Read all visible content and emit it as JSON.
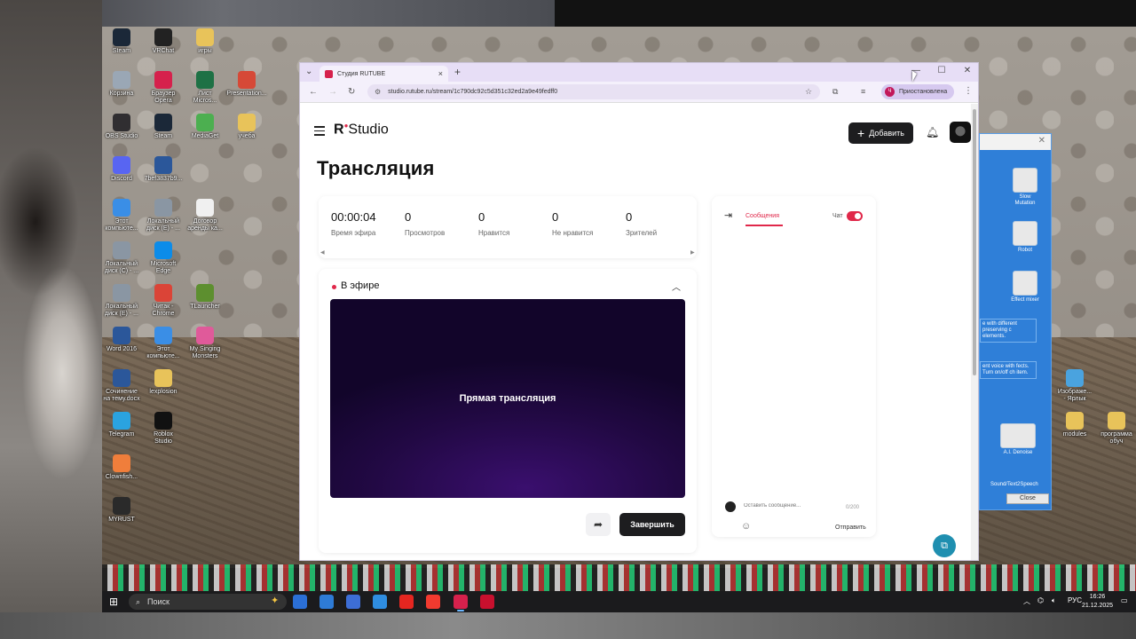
{
  "desktop": {
    "icons": [
      {
        "label": "Steam",
        "icon": "steam-icon",
        "color": "#1b2838"
      },
      {
        "label": "VRChat",
        "icon": "vrchat-icon",
        "color": "#222222"
      },
      {
        "label": "игры",
        "icon": "folder-icon",
        "color": "#e8c35a"
      },
      {
        "label": "Корзина",
        "icon": "recycle-bin-icon",
        "color": "#9aa7b5"
      },
      {
        "label": "Браузер\nOpera",
        "icon": "opera-icon",
        "color": "#d6214c"
      },
      {
        "label": "Лист\nMicros...",
        "icon": "excel-icon",
        "color": "#1e7145"
      },
      {
        "label": "Presentation...",
        "icon": "chrome-app-icon",
        "color": "#d64937"
      },
      {
        "label": "OBS Studio",
        "icon": "obs-icon",
        "color": "#302e31"
      },
      {
        "label": "Steam",
        "icon": "steam-icon",
        "color": "#1b2838"
      },
      {
        "label": "MediaGet",
        "icon": "mediaget-icon",
        "color": "#4caf50"
      },
      {
        "label": "учеба",
        "icon": "folder-icon",
        "color": "#e8c35a"
      },
      {
        "label": "Discord",
        "icon": "discord-icon",
        "color": "#5865f2"
      },
      {
        "label": "7bef3837b9...",
        "icon": "word-icon",
        "color": "#2b579a"
      },
      {
        "label": "Этот\nкомпьюте...",
        "icon": "computer-icon",
        "color": "#3a8ee6"
      },
      {
        "label": "Локальный\nдиск (E) - ...",
        "icon": "drive-icon",
        "color": "#8a96a3"
      },
      {
        "label": "Договор\nаренды ка...",
        "icon": "document-icon",
        "color": "#f0f0f0"
      },
      {
        "label": "Локальный\nдиск (C) - ...",
        "icon": "drive-icon",
        "color": "#8a96a3"
      },
      {
        "label": "Microsoft\nEdge",
        "icon": "edge-icon",
        "color": "#0c8ce9"
      },
      {
        "label": "Локальный\nдиск (E) - ...",
        "icon": "drive-icon",
        "color": "#8a96a3"
      },
      {
        "label": "Читак -\nChrome",
        "icon": "chrome-icon",
        "color": "#db4437"
      },
      {
        "label": "TLauncher",
        "icon": "tlauncher-icon",
        "color": "#5d8f2f"
      },
      {
        "label": "Word 2016",
        "icon": "word-icon",
        "color": "#2b579a"
      },
      {
        "label": "Этот\nкомпьюте...",
        "icon": "computer-icon",
        "color": "#3a8ee6"
      },
      {
        "label": "My Singing\nMonsters",
        "icon": "game-icon",
        "color": "#e05a9a"
      },
      {
        "label": "Сочинение\nна тему.docx",
        "icon": "word-icon",
        "color": "#2b579a"
      },
      {
        "label": "lexplosion",
        "icon": "folder-icon",
        "color": "#e8c35a"
      },
      {
        "label": "Telegram",
        "icon": "telegram-icon",
        "color": "#2aa3e0"
      },
      {
        "label": "Roblox\nStudio",
        "icon": "roblox-icon",
        "color": "#111111"
      },
      {
        "label": "Clownfish...",
        "icon": "clownfish-icon",
        "color": "#f07e3b"
      },
      {
        "label": "MYRUST",
        "icon": "myrust-icon",
        "color": "#2a2a2a"
      }
    ],
    "right_icons": [
      {
        "label": "Изображе...\n- Ярлык",
        "icon": "shortcut-icon",
        "color": "#4aa3df"
      },
      {
        "label": "modules",
        "icon": "folder-icon",
        "color": "#e8c35a"
      },
      {
        "label": "программа\nобуч",
        "icon": "folder-icon",
        "color": "#e8c35a"
      }
    ]
  },
  "plugin_window": {
    "tiles": [
      {
        "caption": "Slow\nMutation"
      },
      {
        "caption": "Robot"
      },
      {
        "caption": "Effect mixer"
      },
      {
        "caption": "A.I. Denoise"
      }
    ],
    "descriptions": [
      "e with different\npreserving\nc elements.",
      "ent voice with\nfects. Turn on/off\nch item."
    ],
    "footer_label": "Sound/Text2Speech",
    "close_label": "Close"
  },
  "browser": {
    "tab_title": "Студия RUTUBE",
    "url": "studio.rutube.ru/stream/1c790dc92c5d351c32ed2a9e49fedff0",
    "profile_initial": "Ч",
    "profile_label": "Приостановлена"
  },
  "page": {
    "logo_letter": "R",
    "logo_text": "Studio",
    "add_button": "Добавить",
    "title": "Трансляция",
    "stats": [
      {
        "value": "00:00:04",
        "label": "Время эфира"
      },
      {
        "value": "0",
        "label": "Просмотров"
      },
      {
        "value": "0",
        "label": "Нравится"
      },
      {
        "value": "0",
        "label": "Не нравится"
      },
      {
        "value": "0",
        "label": "Зрителей"
      }
    ],
    "live_label": "В эфире",
    "player_label": "Прямая трансляция",
    "end_button": "Завершить",
    "chat": {
      "tab_messages": "Сообщения",
      "toggle_label": "Чат",
      "input_placeholder": "Оставить сообщение...",
      "counter": "0/200",
      "send_label": "Отправить"
    }
  },
  "taskbar": {
    "search_placeholder": "Поиск",
    "apps": [
      {
        "icon": "vscode-icon",
        "color": "#2b6fd6"
      },
      {
        "icon": "file-explorer-icon",
        "color": "#2e7bd6"
      },
      {
        "icon": "store-icon",
        "color": "#3d6ed6"
      },
      {
        "icon": "window-icon",
        "color": "#2f8de0"
      },
      {
        "icon": "yandex-icon",
        "color": "#e52620"
      },
      {
        "icon": "yandex-browser-icon",
        "color": "#f23a2f"
      },
      {
        "icon": "chrome-icon",
        "color": "#d6214c"
      },
      {
        "icon": "opera-icon",
        "color": "#c8102e"
      }
    ],
    "language": "РУС",
    "time": "16:26",
    "date": "21.12.2025"
  },
  "colors": {
    "accent": "#e0284a",
    "button_dark": "#1d1d1f",
    "player_purple": "#3a0f6e"
  }
}
